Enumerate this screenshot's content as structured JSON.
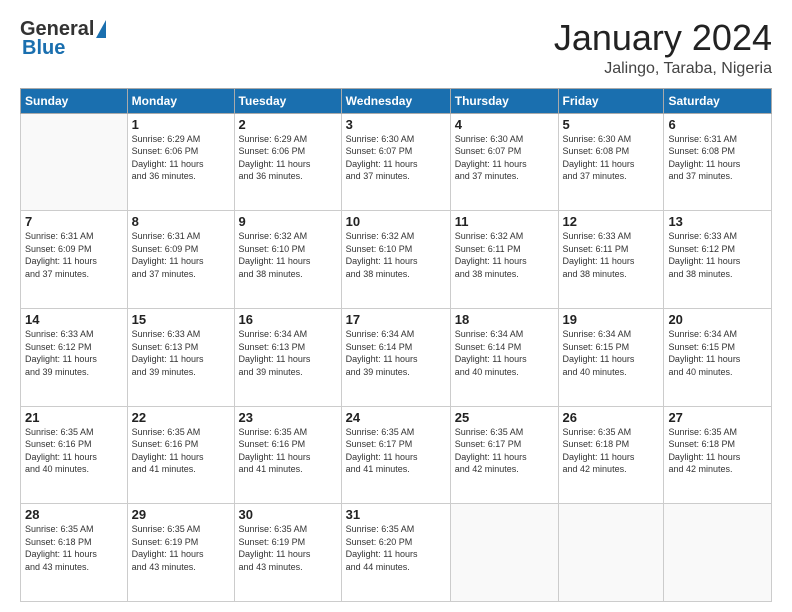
{
  "logo": {
    "general": "General",
    "blue": "Blue"
  },
  "header": {
    "month": "January 2024",
    "location": "Jalingo, Taraba, Nigeria"
  },
  "weekdays": [
    "Sunday",
    "Monday",
    "Tuesday",
    "Wednesday",
    "Thursday",
    "Friday",
    "Saturday"
  ],
  "weeks": [
    [
      {
        "day": "",
        "info": ""
      },
      {
        "day": "1",
        "info": "Sunrise: 6:29 AM\nSunset: 6:06 PM\nDaylight: 11 hours\nand 36 minutes."
      },
      {
        "day": "2",
        "info": "Sunrise: 6:29 AM\nSunset: 6:06 PM\nDaylight: 11 hours\nand 36 minutes."
      },
      {
        "day": "3",
        "info": "Sunrise: 6:30 AM\nSunset: 6:07 PM\nDaylight: 11 hours\nand 37 minutes."
      },
      {
        "day": "4",
        "info": "Sunrise: 6:30 AM\nSunset: 6:07 PM\nDaylight: 11 hours\nand 37 minutes."
      },
      {
        "day": "5",
        "info": "Sunrise: 6:30 AM\nSunset: 6:08 PM\nDaylight: 11 hours\nand 37 minutes."
      },
      {
        "day": "6",
        "info": "Sunrise: 6:31 AM\nSunset: 6:08 PM\nDaylight: 11 hours\nand 37 minutes."
      }
    ],
    [
      {
        "day": "7",
        "info": "Sunrise: 6:31 AM\nSunset: 6:09 PM\nDaylight: 11 hours\nand 37 minutes."
      },
      {
        "day": "8",
        "info": "Sunrise: 6:31 AM\nSunset: 6:09 PM\nDaylight: 11 hours\nand 37 minutes."
      },
      {
        "day": "9",
        "info": "Sunrise: 6:32 AM\nSunset: 6:10 PM\nDaylight: 11 hours\nand 38 minutes."
      },
      {
        "day": "10",
        "info": "Sunrise: 6:32 AM\nSunset: 6:10 PM\nDaylight: 11 hours\nand 38 minutes."
      },
      {
        "day": "11",
        "info": "Sunrise: 6:32 AM\nSunset: 6:11 PM\nDaylight: 11 hours\nand 38 minutes."
      },
      {
        "day": "12",
        "info": "Sunrise: 6:33 AM\nSunset: 6:11 PM\nDaylight: 11 hours\nand 38 minutes."
      },
      {
        "day": "13",
        "info": "Sunrise: 6:33 AM\nSunset: 6:12 PM\nDaylight: 11 hours\nand 38 minutes."
      }
    ],
    [
      {
        "day": "14",
        "info": "Sunrise: 6:33 AM\nSunset: 6:12 PM\nDaylight: 11 hours\nand 39 minutes."
      },
      {
        "day": "15",
        "info": "Sunrise: 6:33 AM\nSunset: 6:13 PM\nDaylight: 11 hours\nand 39 minutes."
      },
      {
        "day": "16",
        "info": "Sunrise: 6:34 AM\nSunset: 6:13 PM\nDaylight: 11 hours\nand 39 minutes."
      },
      {
        "day": "17",
        "info": "Sunrise: 6:34 AM\nSunset: 6:14 PM\nDaylight: 11 hours\nand 39 minutes."
      },
      {
        "day": "18",
        "info": "Sunrise: 6:34 AM\nSunset: 6:14 PM\nDaylight: 11 hours\nand 40 minutes."
      },
      {
        "day": "19",
        "info": "Sunrise: 6:34 AM\nSunset: 6:15 PM\nDaylight: 11 hours\nand 40 minutes."
      },
      {
        "day": "20",
        "info": "Sunrise: 6:34 AM\nSunset: 6:15 PM\nDaylight: 11 hours\nand 40 minutes."
      }
    ],
    [
      {
        "day": "21",
        "info": "Sunrise: 6:35 AM\nSunset: 6:16 PM\nDaylight: 11 hours\nand 40 minutes."
      },
      {
        "day": "22",
        "info": "Sunrise: 6:35 AM\nSunset: 6:16 PM\nDaylight: 11 hours\nand 41 minutes."
      },
      {
        "day": "23",
        "info": "Sunrise: 6:35 AM\nSunset: 6:16 PM\nDaylight: 11 hours\nand 41 minutes."
      },
      {
        "day": "24",
        "info": "Sunrise: 6:35 AM\nSunset: 6:17 PM\nDaylight: 11 hours\nand 41 minutes."
      },
      {
        "day": "25",
        "info": "Sunrise: 6:35 AM\nSunset: 6:17 PM\nDaylight: 11 hours\nand 42 minutes."
      },
      {
        "day": "26",
        "info": "Sunrise: 6:35 AM\nSunset: 6:18 PM\nDaylight: 11 hours\nand 42 minutes."
      },
      {
        "day": "27",
        "info": "Sunrise: 6:35 AM\nSunset: 6:18 PM\nDaylight: 11 hours\nand 42 minutes."
      }
    ],
    [
      {
        "day": "28",
        "info": "Sunrise: 6:35 AM\nSunset: 6:18 PM\nDaylight: 11 hours\nand 43 minutes."
      },
      {
        "day": "29",
        "info": "Sunrise: 6:35 AM\nSunset: 6:19 PM\nDaylight: 11 hours\nand 43 minutes."
      },
      {
        "day": "30",
        "info": "Sunrise: 6:35 AM\nSunset: 6:19 PM\nDaylight: 11 hours\nand 43 minutes."
      },
      {
        "day": "31",
        "info": "Sunrise: 6:35 AM\nSunset: 6:20 PM\nDaylight: 11 hours\nand 44 minutes."
      },
      {
        "day": "",
        "info": ""
      },
      {
        "day": "",
        "info": ""
      },
      {
        "day": "",
        "info": ""
      }
    ]
  ]
}
